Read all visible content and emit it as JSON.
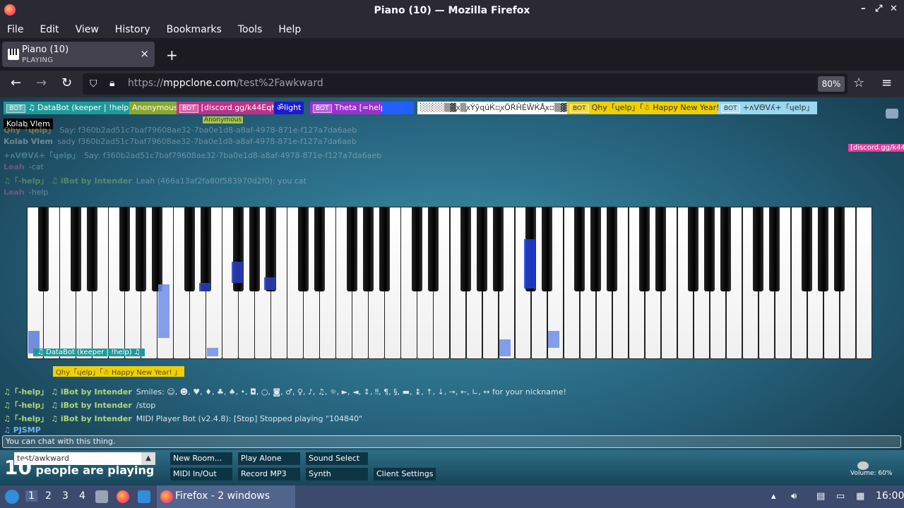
{
  "window": {
    "title": "Piano (10) — Mozilla Firefox",
    "controls": [
      "–",
      "⤢",
      "✕"
    ]
  },
  "menu": [
    "File",
    "Edit",
    "View",
    "History",
    "Bookmarks",
    "Tools",
    "Help"
  ],
  "tab": {
    "title": "Piano (10)",
    "subtitle": "PLAYING",
    "close": "×",
    "new_tab": "+"
  },
  "nav": {
    "back": "←",
    "forward": "→",
    "reload": "↻",
    "url_prefix": "https://",
    "url_host": "mppclone.com",
    "url_path": "/test%2Fawkward",
    "zoom": "80%",
    "star": "☆",
    "menu": "≡"
  },
  "users": [
    {
      "bot": "BOT",
      "name": "♫ DataBot (keeper | !help) ♫",
      "color": "#1f9a9a"
    },
    {
      "bot": "",
      "name": "Anonymous",
      "color": "#8aa82e"
    },
    {
      "bot": "BOT",
      "name": "[discord.gg/k44Eqha]",
      "color": "#c0308a"
    },
    {
      "bot": "",
      "name": "ॐlight",
      "color": "#1a1ad0"
    },
    {
      "bot": "BOT",
      "name": "Theta [=help]",
      "color": "#9b2fd0"
    },
    {
      "bot": "",
      "name": "",
      "color": "#2060ff"
    },
    {
      "bot": "",
      "name": "░░░░▒▓ꭗ▒ꭗÝŷɋúЌ▫ꭗÕŔĤÉŴЌÅꭗ▫▒▓░░░",
      "color": "#ffffff"
    },
    {
      "bot": "BOT",
      "name": "Qhy「ɥelp」「☃ Happy New Year! 」",
      "color": "#f0d000"
    },
    {
      "bot": "BOT",
      "name": "+ʌVƟVʎ+「ɥelp」",
      "color": "#9ad8f0"
    }
  ],
  "tooltip": "Kolab Vlem",
  "anon_tag": "Anonymous",
  "discord_right": "[discord.gg/k44Eqh",
  "chat": [
    {
      "who": "Qhy「ɥelp」",
      "msg": "Say: f360b2ad51c7baf79608ae32-7ba0e1d8-a8af-4978-871e-f127a7da6aeb",
      "color": "#ffe066"
    },
    {
      "who": "Kolab Vlem",
      "msg": "sady f360b2ad51c7baf79608ae32-7ba0e1d8-a8af-4978-871e-f127a7da6aeb",
      "color": "#ffffff"
    },
    {
      "who": "+ʌVƟVʎ+「ɥelp」",
      "msg": "Say: f360b2ad51c7baf79608ae32-7ba0e1d8-a8af-4978-871e-f127a7da6aeb",
      "color": "#9ad8f0"
    },
    {
      "who": "Leah",
      "msg": "-cat",
      "color": "#ff6fb0"
    },
    {
      "who": "♫「-help」 ♫ iBot by Intender",
      "msg": "Leah (466a13af2fa80f583970d2f0): you cat",
      "color": "#b6e07a"
    },
    {
      "who": "Leah",
      "msg": "-help",
      "color": "#ff6fb0"
    },
    {
      "who": "♫「-help」 ♫ iBot by Intender",
      "msg": "Smiles: ☺, ☻, ♥, ♦, ♣, ♠, •, ◘, ○, ◙, ♂, ♀, ♪, ♫, ☼, ►, ◄, ↕, ‼, ¶, §, ▬, ↨, ↑, ↓, →, ←, ∟, ↔ for your nickname!",
      "color": "#b6e07a"
    },
    {
      "who": "♫「-help」 ♫ iBot by Intender",
      "msg": "/stop",
      "color": "#b6e07a"
    },
    {
      "who": "♫「-help」 ♫ iBot by Intender",
      "msg": "MIDI Player Bot (v2.4.8): [Stop] Stopped playing \"104840\"",
      "color": "#b6e07a"
    },
    {
      "who": "♫ PJSMP",
      "msg": "",
      "color": "#7ab8ff"
    }
  ],
  "float_names": [
    "♫ DataBot (keeper | !help) ♫",
    "Qhy「ɥelp」「☃ Happy New Year! 」"
  ],
  "chat_placeholder": "You can chat with this thing.",
  "room": {
    "name": "test/awkward",
    "arrow": "▲"
  },
  "count": {
    "num": "10",
    "label": " people are playing"
  },
  "buttons": [
    "New Room...",
    "Play Alone",
    "Sound Select",
    "MIDI In/Out",
    "Record MP3",
    "Synth",
    "Client Settings"
  ],
  "volume": "Volume: 60%",
  "taskbar": {
    "workspaces": [
      "1",
      "2",
      "3",
      "4"
    ],
    "task": "Firefox - 2 windows",
    "clock": "16:00"
  }
}
